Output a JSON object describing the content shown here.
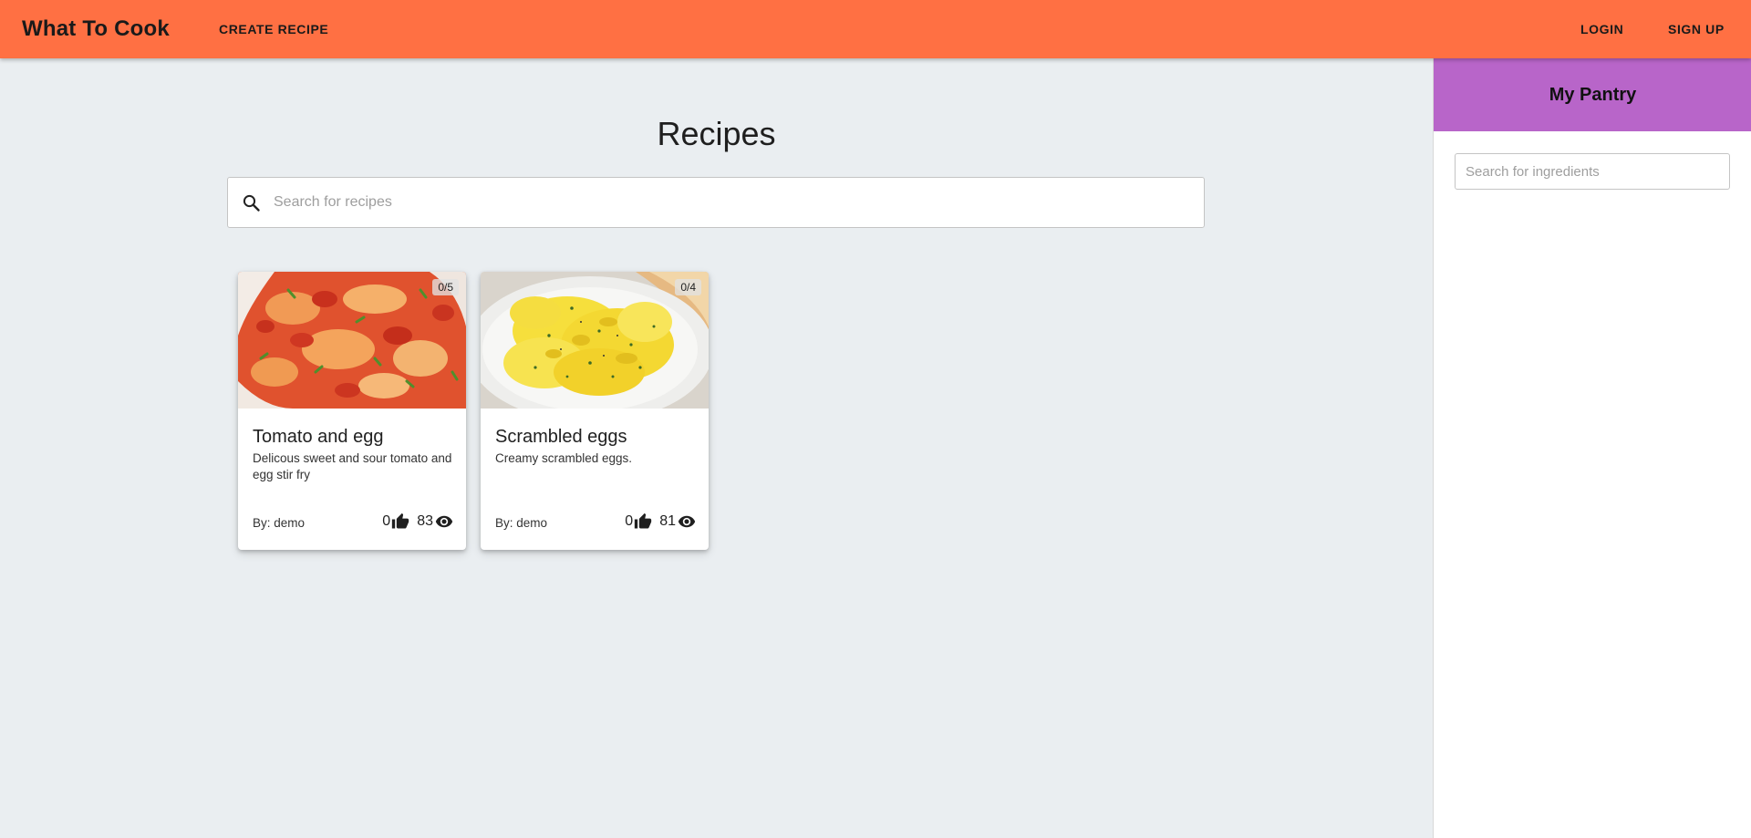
{
  "header": {
    "brand": "What To Cook",
    "nav": {
      "create_recipe": "CREATE RECIPE",
      "login": "LOGIN",
      "sign_up": "SIGN UP"
    },
    "color": "#ff7043"
  },
  "main": {
    "title": "Recipes",
    "search": {
      "placeholder": "Search for recipes",
      "value": ""
    },
    "recipes": [
      {
        "image": "tomato-and-egg-photo",
        "badge": "0/5",
        "title": "Tomato and egg",
        "description": "Delicous sweet and sour tomato and egg stir fry",
        "author": "By: demo",
        "likes": "0",
        "views": "83"
      },
      {
        "image": "scrambled-eggs-photo",
        "badge": "0/4",
        "title": "Scrambled eggs",
        "description": "Creamy scrambled eggs.",
        "author": "By: demo",
        "likes": "0",
        "views": "81"
      }
    ],
    "icons": {
      "search": "search-icon",
      "like": "thumb-up-icon",
      "views": "eye-icon"
    }
  },
  "pantry": {
    "title": "My Pantry",
    "search": {
      "placeholder": "Search for ingredients",
      "value": ""
    },
    "color": "#b865c9"
  }
}
